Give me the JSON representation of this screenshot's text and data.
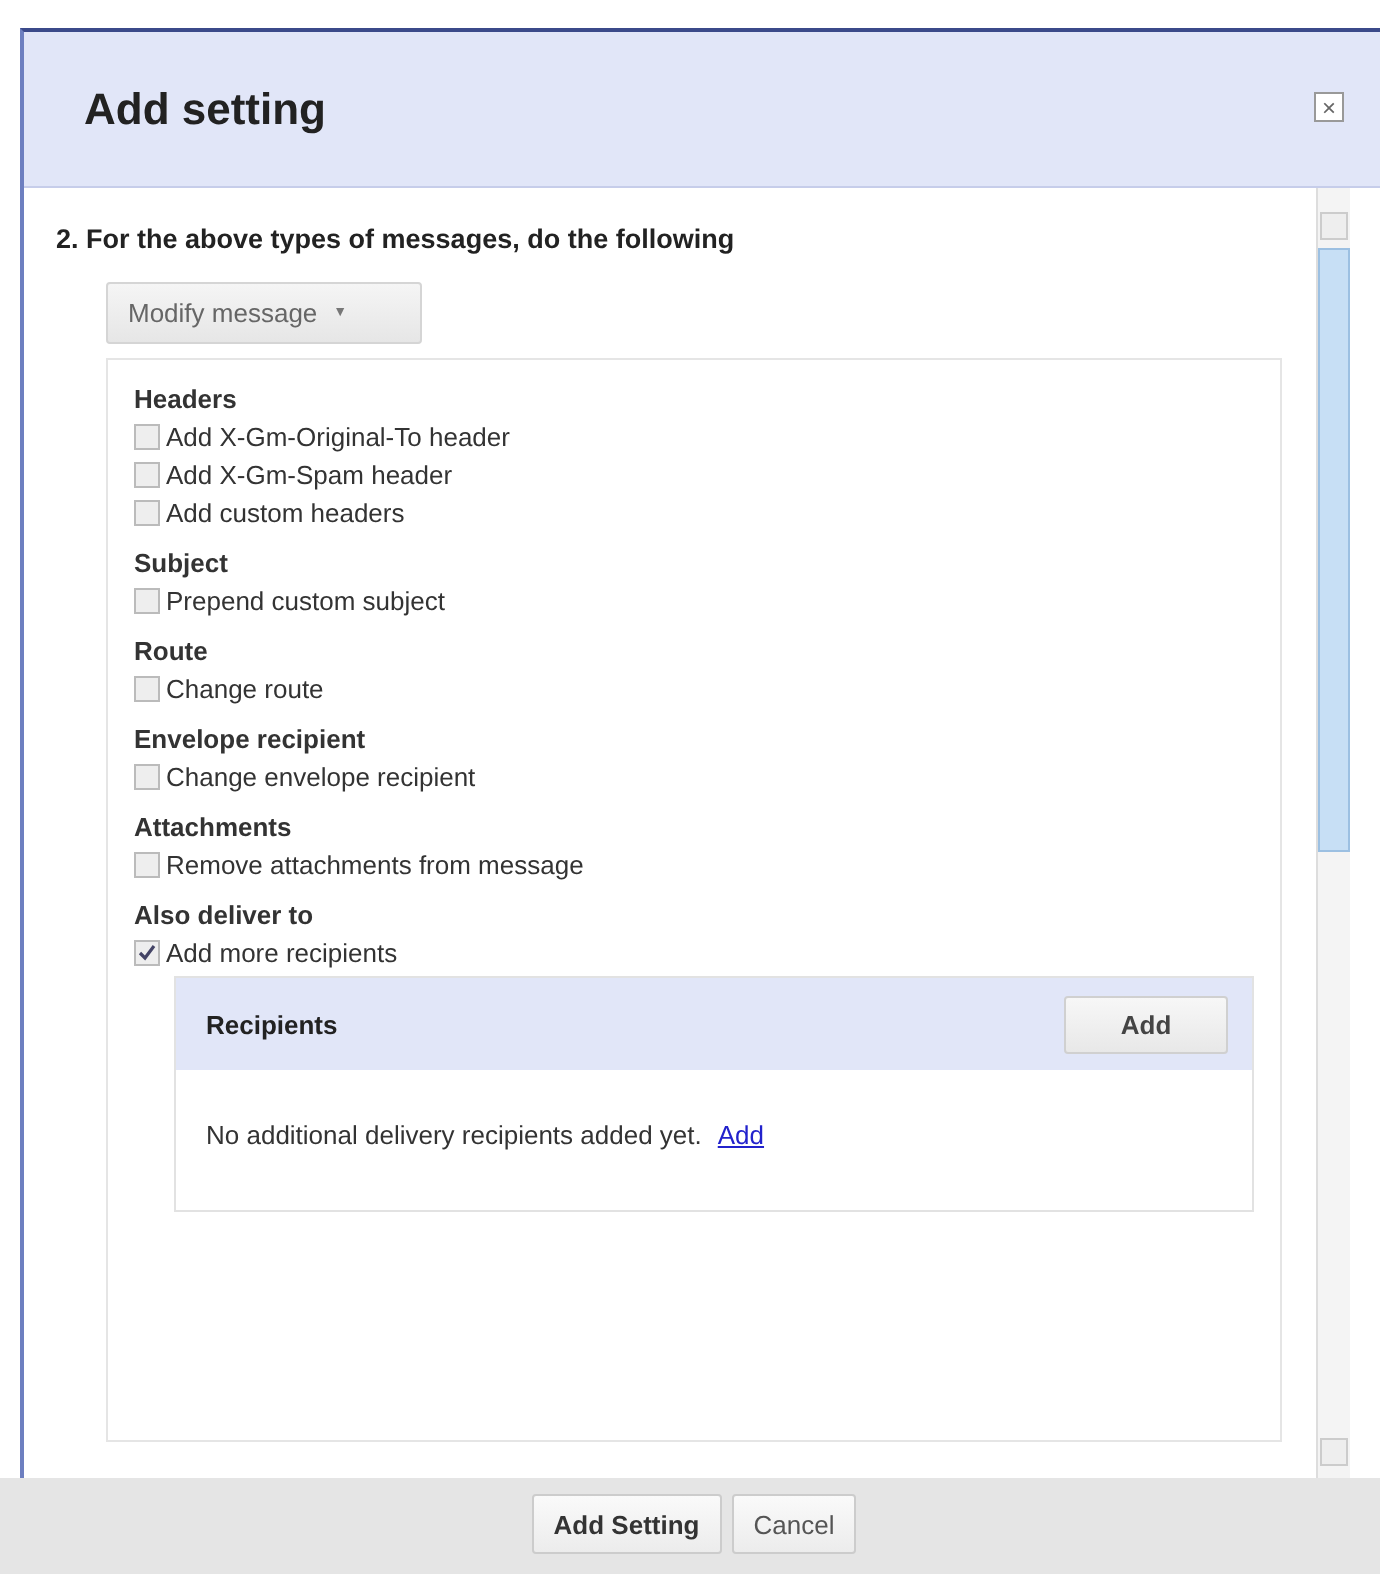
{
  "dialog": {
    "title": "Add setting",
    "close": "×"
  },
  "step": {
    "heading": "2. For the above types of messages, do the following",
    "dropdown": {
      "label": "Modify message",
      "caret": "▼"
    }
  },
  "sections": [
    {
      "title": "Headers",
      "options": [
        {
          "label": "Add X-Gm-Original-To header",
          "checked": false
        },
        {
          "label": "Add X-Gm-Spam header",
          "checked": false
        },
        {
          "label": "Add custom headers",
          "checked": false
        }
      ]
    },
    {
      "title": "Subject",
      "options": [
        {
          "label": "Prepend custom subject",
          "checked": false
        }
      ]
    },
    {
      "title": "Route",
      "options": [
        {
          "label": "Change route",
          "checked": false
        }
      ]
    },
    {
      "title": "Envelope recipient",
      "options": [
        {
          "label": "Change envelope recipient",
          "checked": false
        }
      ]
    },
    {
      "title": "Attachments",
      "options": [
        {
          "label": "Remove attachments from message",
          "checked": false
        }
      ]
    },
    {
      "title": "Also deliver to",
      "options": [
        {
          "label": "Add more recipients",
          "checked": true
        }
      ],
      "recipients": {
        "title": "Recipients",
        "add_button": "Add",
        "empty_text": "No additional delivery recipients added yet.",
        "link": "Add"
      }
    }
  ],
  "footer": {
    "buttons": [
      {
        "label": "Add Setting",
        "kind": "primary"
      },
      {
        "label": "Cancel",
        "kind": "secondary"
      }
    ]
  }
}
